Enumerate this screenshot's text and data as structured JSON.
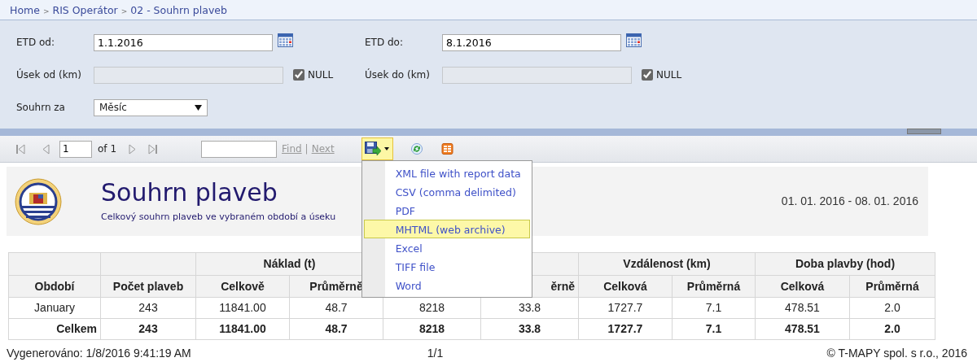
{
  "breadcrumb": [
    {
      "label": "Home",
      "separator": ">"
    },
    {
      "label": "RIS Operátor",
      "separator": ">"
    },
    {
      "label": "02 - Souhrn plaveb"
    }
  ],
  "parameters": [
    {
      "kind": "date",
      "label": "ETD od:",
      "value": "1.1.2016"
    },
    {
      "kind": "date",
      "label": "ETD do:",
      "value": "8.1.2016"
    },
    {
      "kind": "number",
      "label": "Úsek od (km)",
      "disabled": true,
      "null_label": "NULL",
      "null_checked": true
    },
    {
      "kind": "number",
      "label": "Úsek do (km)",
      "disabled": true,
      "null_label": "NULL",
      "null_checked": true
    },
    {
      "kind": "select",
      "label": "Souhrn za",
      "value": "Měsíc"
    }
  ],
  "toolbar": {
    "page": "1",
    "page_of": "of 1",
    "find_label": "Find",
    "find_separator": "|",
    "next_label": "Next",
    "find_disabled": true
  },
  "export_menu": {
    "open": true,
    "items": [
      {
        "label": "XML file with report data",
        "selected": false
      },
      {
        "label": "CSV (comma delimited)",
        "selected": false
      },
      {
        "label": "PDF",
        "selected": false
      },
      {
        "label": "MHTML (web archive)",
        "selected": true
      },
      {
        "label": "Excel",
        "selected": false
      },
      {
        "label": "TIFF file",
        "selected": false
      },
      {
        "label": "Word",
        "selected": false
      }
    ]
  },
  "report": {
    "title": "Souhrn plaveb",
    "subtitle": "Celkový souhrn plaveb ve vybraném období a úseku",
    "date_range": "01. 01. 2016 - 08. 01. 2016"
  },
  "table": {
    "groups": [
      {
        "columns": [
          {
            "label": "Období"
          }
        ]
      },
      {
        "columns": [
          {
            "label": "Počet plaveb"
          }
        ]
      },
      {
        "label": "Náklad (t)",
        "columns": [
          {
            "label": "Celkově"
          },
          {
            "label": "Průměrně"
          }
        ]
      },
      {
        "columns": [
          {},
          {
            "label": "ěrně"
          }
        ]
      },
      {
        "label": "Vzdálenost (km)",
        "columns": [
          {
            "label": "Celková"
          },
          {
            "label": "Průměrná"
          }
        ]
      },
      {
        "label": "Doba plavby (hod)",
        "columns": [
          {
            "label": "Celková"
          },
          {
            "label": "Průměrná"
          }
        ]
      }
    ],
    "rows": [
      {
        "kind": "data",
        "cells": [
          "January",
          "243",
          "11841.00",
          "48.7",
          "8218",
          "33.8",
          "1727.7",
          "7.1",
          "478.51",
          "2.0"
        ]
      },
      {
        "kind": "total",
        "cells": [
          "Celkem",
          "243",
          "11841.00",
          "48.7",
          "8218",
          "33.8",
          "1727.7",
          "7.1",
          "478.51",
          "2.0"
        ]
      }
    ]
  },
  "footer": {
    "generated": "Vygenerováno: 1/8/2016 9:41:19 AM",
    "page": "1/1",
    "copyright": "© T-MAPY spol. s r.o., 2016"
  }
}
